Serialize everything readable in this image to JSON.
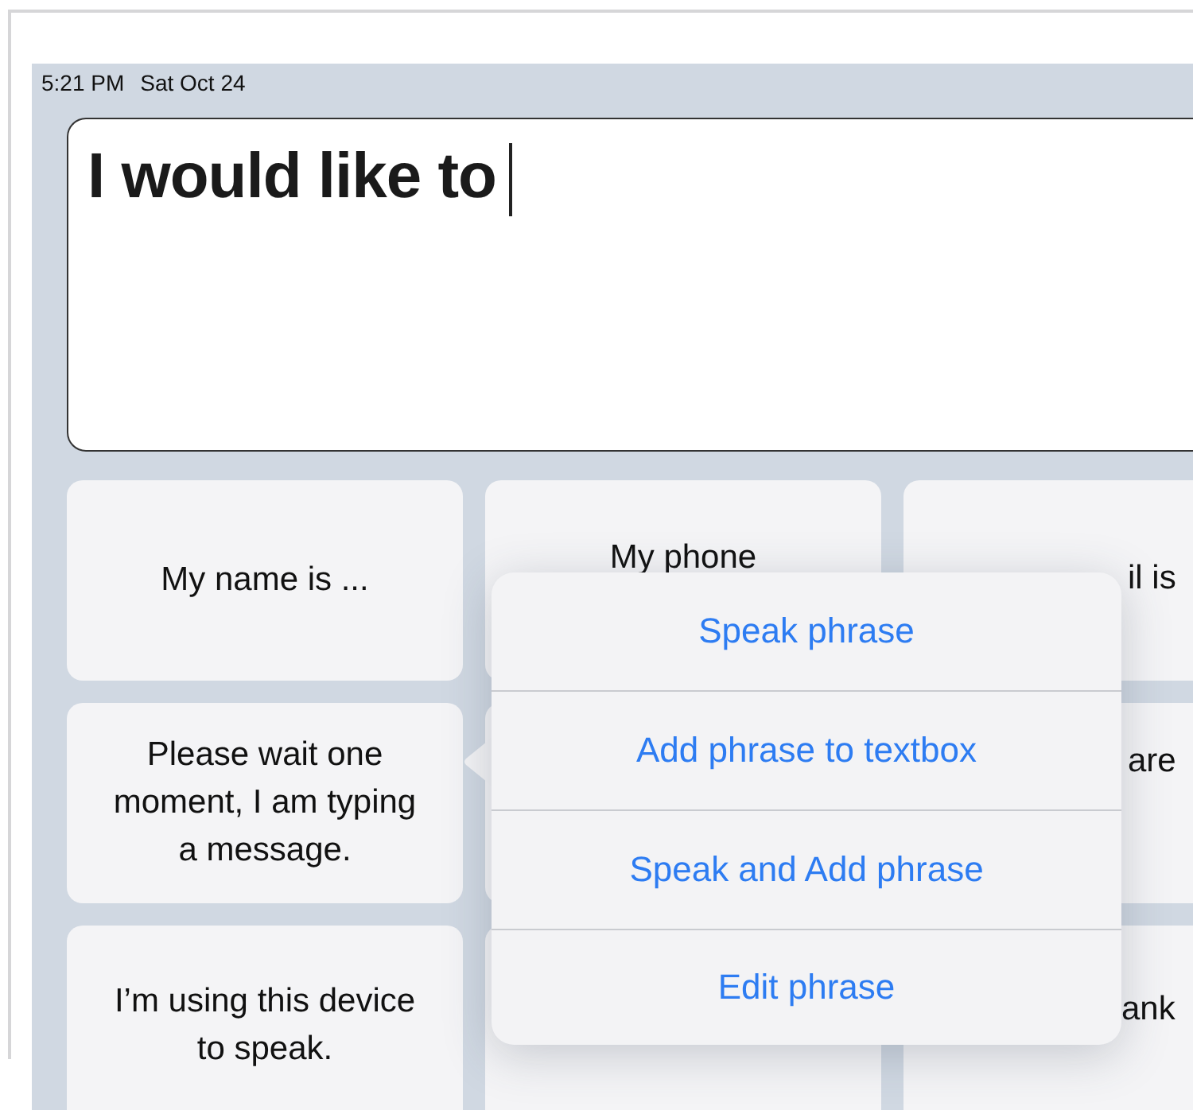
{
  "status_bar": {
    "time": "5:21 PM",
    "date": "Sat Oct 24"
  },
  "textbox": {
    "value": "I would like to",
    "focused": true
  },
  "phrase_rows": [
    {
      "tiles": [
        {
          "kind": "phrase",
          "text": "My name is ..."
        },
        {
          "kind": "phrase",
          "text": "My phone"
        },
        {
          "kind": "phrase",
          "text": "il is"
        }
      ]
    },
    {
      "tiles": [
        {
          "kind": "phrase",
          "text": "Please wait one moment, I am typing a message."
        },
        {
          "kind": "covered"
        },
        {
          "kind": "phrase",
          "text": "are"
        }
      ]
    },
    {
      "tiles": [
        {
          "kind": "phrase",
          "text": "I’m using this device to speak."
        },
        {
          "kind": "covered"
        },
        {
          "kind": "phrase",
          "text": "ank"
        }
      ]
    }
  ],
  "popover_menu": {
    "items": [
      {
        "label": "Speak phrase"
      },
      {
        "label": "Add phrase to textbox"
      },
      {
        "label": "Speak and Add phrase"
      },
      {
        "label": "Edit phrase"
      }
    ]
  }
}
